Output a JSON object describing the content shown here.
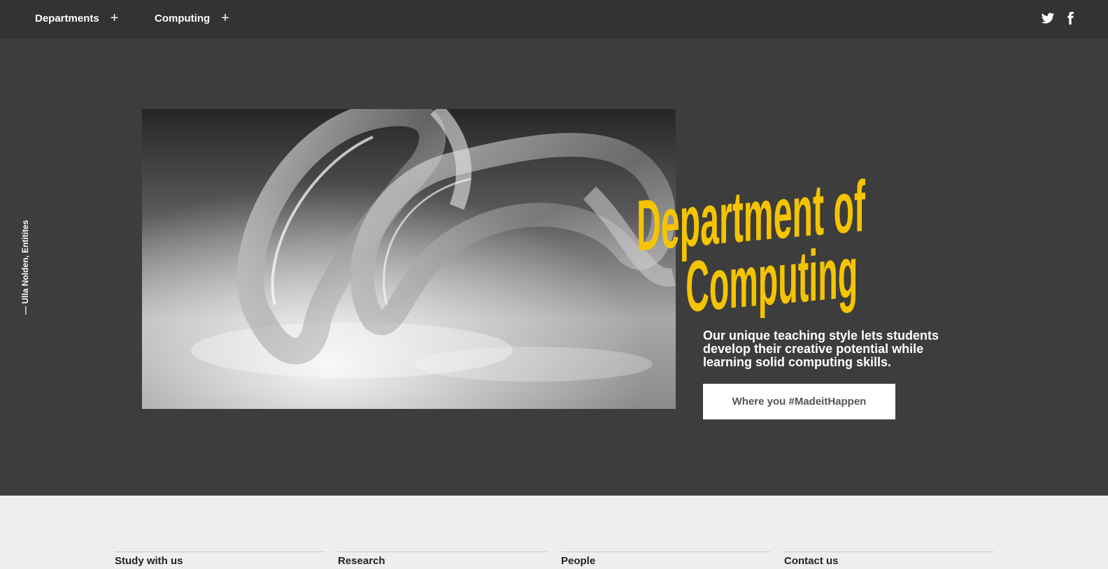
{
  "nav": {
    "departments_label": "Departments",
    "computing_label": "Computing",
    "expand_symbol": "+",
    "social": [
      "twitter-icon",
      "facebook-icon"
    ]
  },
  "hero": {
    "credit": "— Ulla Nolden, Entitites",
    "title_line1": "Department of",
    "title_line2": "Computing",
    "intro": "Our unique teaching style lets students develop their creative potential while learning solid computing skills.",
    "cta_label": "Where you #MadeitHappen",
    "accent_color": "#f5c400"
  },
  "footer": {
    "links": [
      "Study with us",
      "Research",
      "People",
      "Contact us"
    ]
  }
}
